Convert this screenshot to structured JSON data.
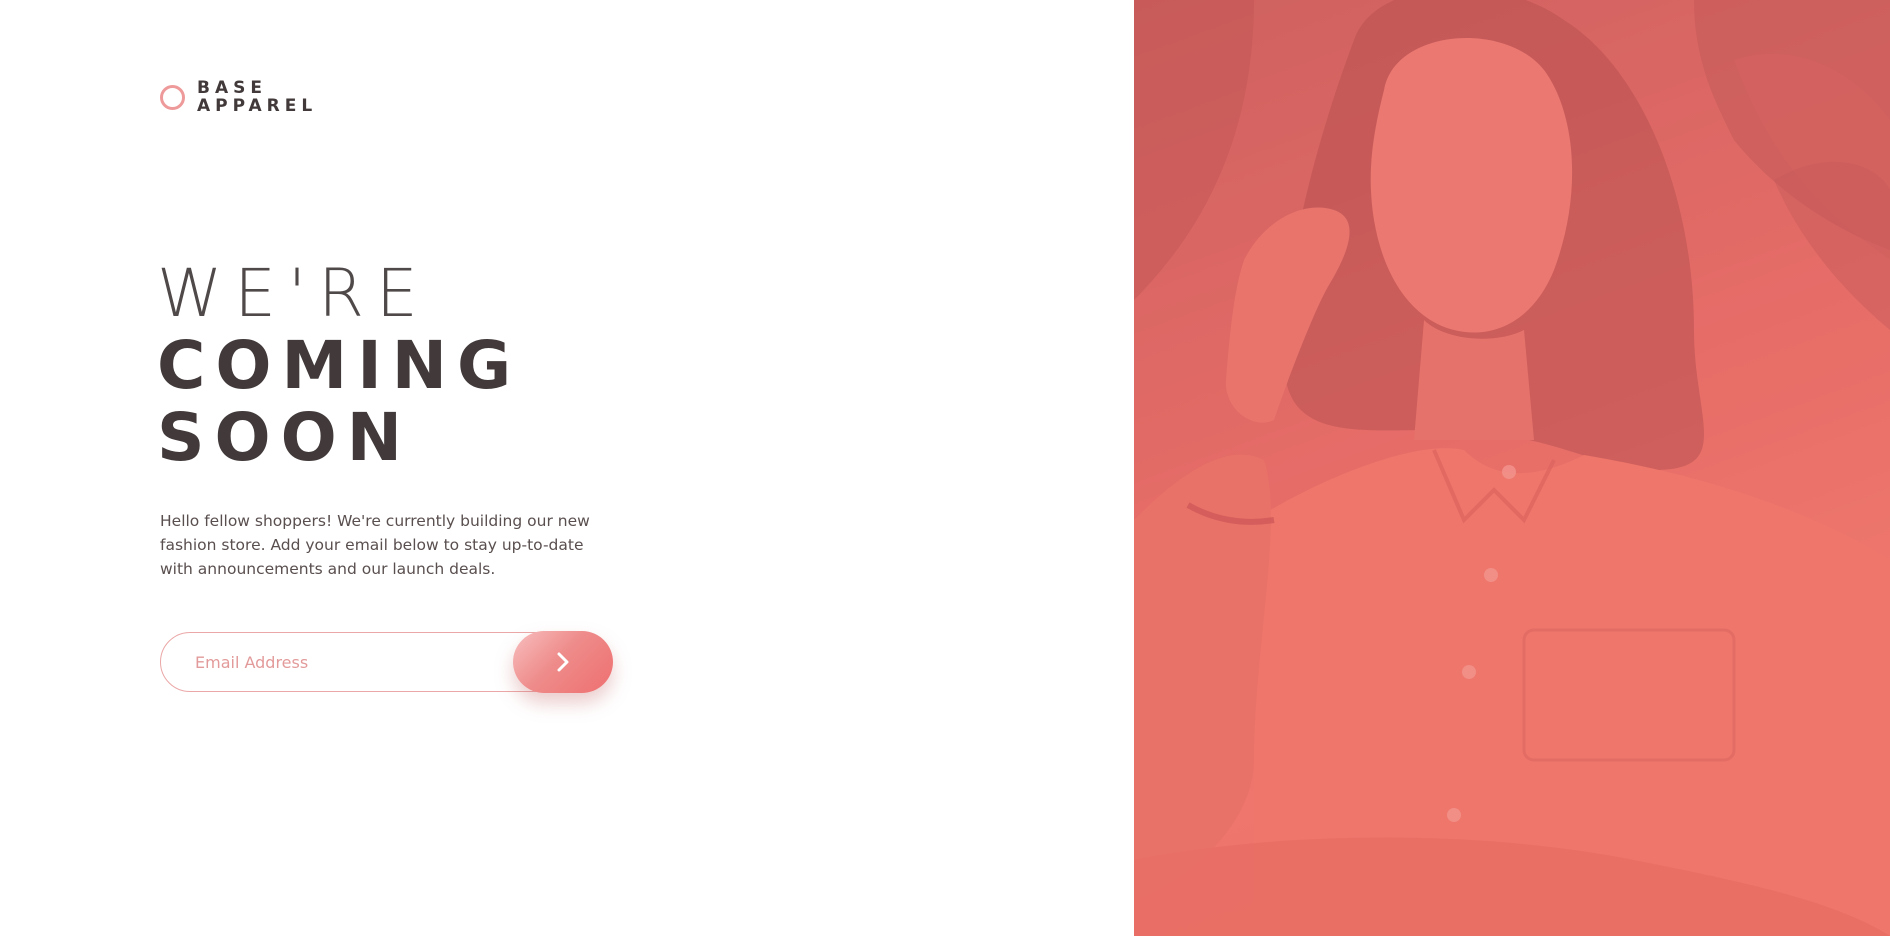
{
  "brand": {
    "line1": "BASE",
    "line2": "APPAREL",
    "ring_color": "#ef9a9a"
  },
  "headline": {
    "light": "WE'RE",
    "bold1": "COMING",
    "bold2": "SOON"
  },
  "description": "Hello fellow shoppers! We're currently building our new fashion store. Add your email below to stay up-to-date with announcements and our launch deals.",
  "form": {
    "email_placeholder": "Email Address",
    "submit_icon": "chevron-right-icon"
  },
  "hero": {
    "subject": "hero-image",
    "overlay_color": "#e66d68"
  },
  "colors": {
    "accent": "#ef6f6f",
    "text": "#423a3a",
    "desc": "#5a4f4f"
  }
}
